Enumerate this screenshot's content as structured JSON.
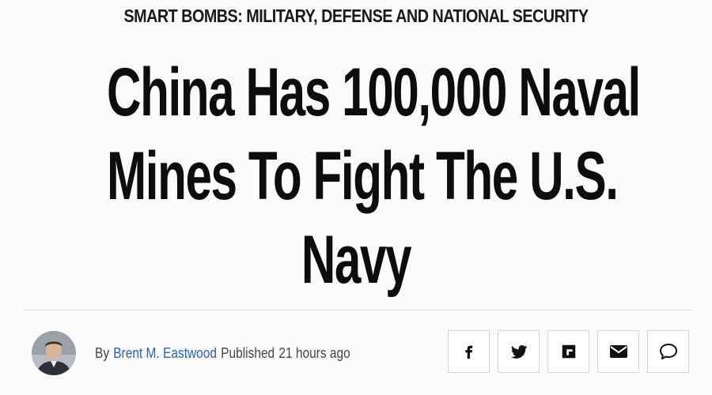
{
  "article": {
    "category": "SMART BOMBS: MILITARY, DEFENSE AND NATIONAL SECURITY",
    "headline_lines": [
      "China Has 100,000 Naval",
      "Mines To Fight The U.S.",
      "Navy"
    ]
  },
  "byline": {
    "by_label": "By",
    "author": "Brent M. Eastwood",
    "published_label": "Published",
    "time_ago": "21 hours ago"
  },
  "share": {
    "icons": [
      "facebook-icon",
      "twitter-icon",
      "flipboard-icon",
      "email-icon",
      "comment-icon"
    ]
  }
}
